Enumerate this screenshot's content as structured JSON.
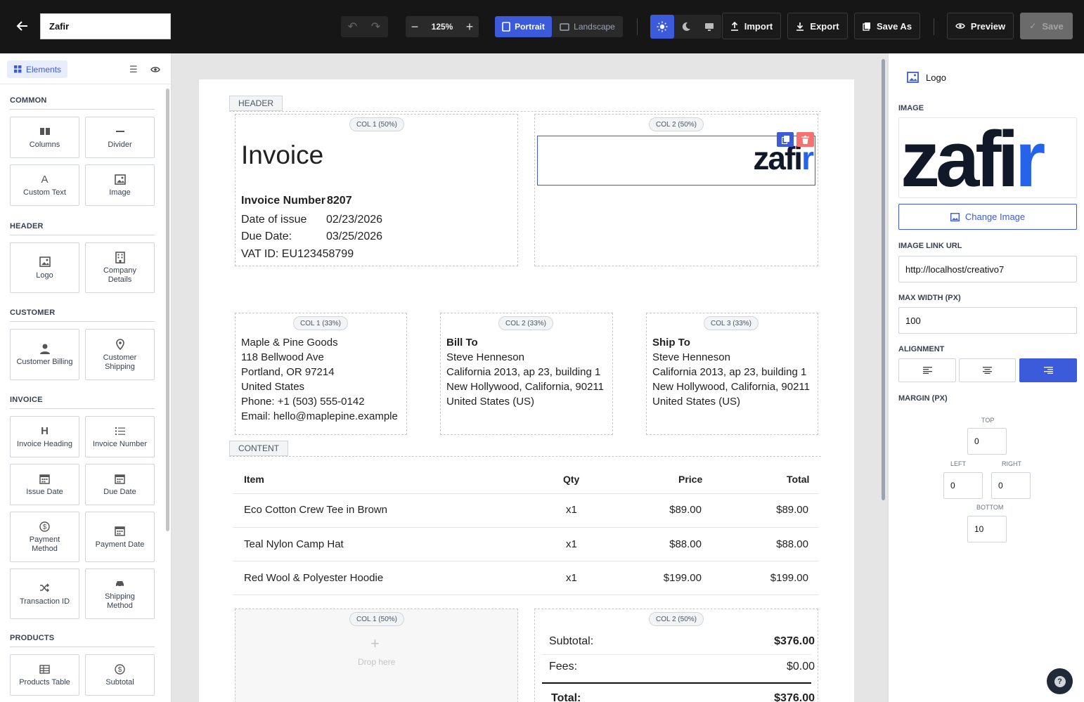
{
  "topbar": {
    "document_title": "Zafir",
    "zoom": "125%",
    "orientation": {
      "portrait": "Portrait",
      "landscape": "Landscape"
    },
    "import_label": "Import",
    "export_label": "Export",
    "save_as_label": "Save As",
    "preview_label": "Preview",
    "save_label": "Save"
  },
  "left_panel": {
    "tab_label": "Elements",
    "sections": {
      "common": "COMMON",
      "header": "HEADER",
      "customer": "CUSTOMER",
      "invoice": "INVOICE",
      "products": "PRODUCTS"
    },
    "items": {
      "columns": "Columns",
      "divider": "Divider",
      "custom_text": "Custom Text",
      "image": "Image",
      "logo": "Logo",
      "company_details": "Company Details",
      "customer_billing": "Customer Billing",
      "customer_shipping": "Customer Shipping",
      "invoice_heading": "Invoice Heading",
      "invoice_number": "Invoice Number",
      "issue_date": "Issue Date",
      "due_date": "Due Date",
      "payment_method": "Payment Method",
      "payment_date": "Payment Date",
      "transaction_id": "Transaction ID",
      "shipping_method": "Shipping Method",
      "products_table": "Products Table",
      "subtotal": "Subtotal"
    }
  },
  "document": {
    "header_tag": "HEADER",
    "content_tag": "CONTENT",
    "col1_50": "COL 1 (50%)",
    "col2_50": "COL 2 (50%)",
    "col1_33": "COL 1 (33%)",
    "col2_33": "COL 2 (33%)",
    "col3_33": "COL 3 (33%)",
    "heading": "Invoice",
    "invoice_number_label": "Invoice Number",
    "invoice_number": "8207",
    "date_of_issue_label": "Date of issue",
    "date_of_issue": "02/23/2026",
    "due_date_label": "Due Date:",
    "due_date": "03/25/2026",
    "vat": "VAT ID: EU123458799",
    "logo_text": "zafir",
    "company": {
      "name": "Maple & Pine Goods",
      "street": "118 Bellwood Ave",
      "city": "Portland, OR 97214",
      "country": "United States",
      "phone": "Phone: +1 (503) 555-0142",
      "email": "Email: hello@maplepine.example"
    },
    "bill_to": {
      "title": "Bill To",
      "name": "Steve Henneson",
      "line1": "California 2013, ap 23, building 1",
      "line2": "New Hollywood, California, 90211",
      "country": "United States (US)"
    },
    "ship_to": {
      "title": "Ship To",
      "name": "Steve Henneson",
      "line1": "California 2013, ap 23, building 1",
      "line2": "New Hollywood, California, 90211",
      "country": "United States (US)"
    },
    "table": {
      "headers": {
        "item": "Item",
        "qty": "Qty",
        "price": "Price",
        "total": "Total"
      },
      "rows": [
        {
          "item": "Eco Cotton Crew Tee in Brown",
          "qty": "x1",
          "price": "$89.00",
          "total": "$89.00"
        },
        {
          "item": "Teal Nylon Camp Hat",
          "qty": "x1",
          "price": "$88.00",
          "total": "$88.00"
        },
        {
          "item": "Red Wool & Polyester Hoodie",
          "qty": "x1",
          "price": "$199.00",
          "total": "$199.00"
        }
      ]
    },
    "drop_here": "Drop here",
    "totals": {
      "subtotal_label": "Subtotal:",
      "subtotal": "$376.00",
      "fees_label": "Fees:",
      "fees": "$0.00",
      "total_label": "Total:",
      "total": "$376.00"
    }
  },
  "right_panel": {
    "element_title": "Logo",
    "image_label": "IMAGE",
    "change_image_label": "Change Image",
    "image_link_label": "IMAGE LINK URL",
    "image_link_value": "http://localhost/creativo7",
    "max_width_label": "MAX WIDTH (PX)",
    "max_width_value": "100",
    "alignment_label": "ALIGNMENT",
    "alignment_selected": "right",
    "margin_label": "MARGIN (PX)",
    "margin": {
      "top_label": "TOP",
      "top": "0",
      "left_label": "LEFT",
      "left": "0",
      "right_label": "RIGHT",
      "right": "0",
      "bottom_label": "BOTTOM",
      "bottom": "10"
    }
  },
  "colors": {
    "accent": "#3b5bdb",
    "danger": "#ef4444",
    "topbar": "#161616"
  }
}
